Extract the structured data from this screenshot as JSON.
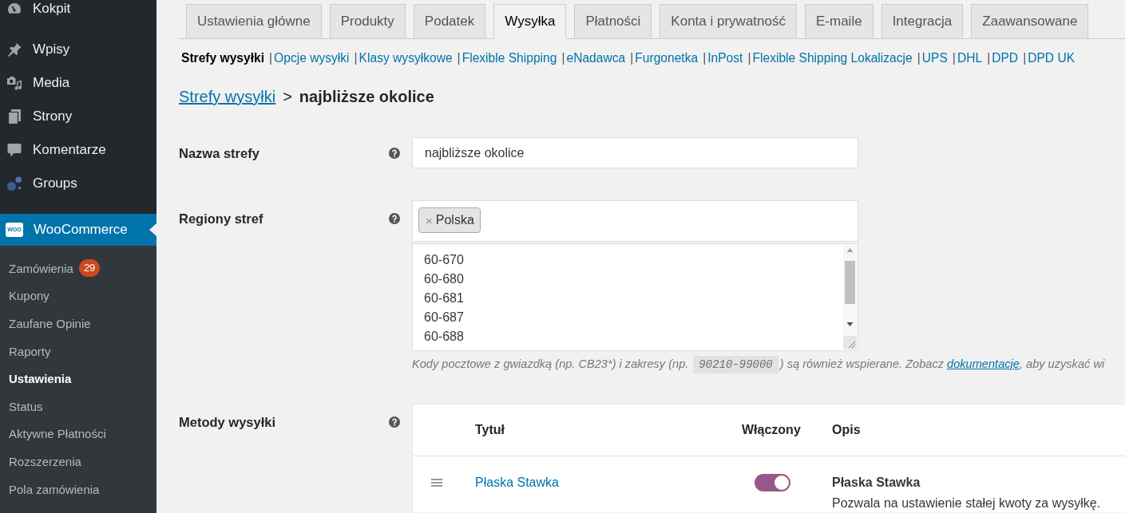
{
  "sidebar": {
    "menu": [
      {
        "label": "Kokpit",
        "selected": false
      },
      {
        "label": "Wpisy",
        "selected": false
      },
      {
        "label": "Media",
        "selected": false
      },
      {
        "label": "Strony",
        "selected": false
      },
      {
        "label": "Komentarze",
        "selected": false
      },
      {
        "label": "Groups",
        "selected": false
      },
      {
        "label": "WooCommerce",
        "selected": true,
        "logo_text": "WOO",
        "submenu": [
          {
            "label": "Zamówienia",
            "badge": "29",
            "selected": false
          },
          {
            "label": "Kupony",
            "selected": false
          },
          {
            "label": "Zaufane Opinie",
            "selected": false
          },
          {
            "label": "Raporty",
            "selected": false
          },
          {
            "label": "Ustawienia",
            "selected": true
          },
          {
            "label": "Status",
            "selected": false
          },
          {
            "label": "Aktywne Płatności",
            "selected": false
          },
          {
            "label": "Rozszerzenia",
            "selected": false
          },
          {
            "label": "Pola zamówienia",
            "selected": false
          }
        ]
      }
    ]
  },
  "tabs": [
    {
      "label": "Ustawienia główne",
      "selected": false
    },
    {
      "label": "Produkty",
      "selected": false
    },
    {
      "label": "Podatek",
      "selected": false
    },
    {
      "label": "Wysyłka",
      "selected": true
    },
    {
      "label": "Płatności",
      "selected": false
    },
    {
      "label": "Konta i prywatność",
      "selected": false
    },
    {
      "label": "E-maile",
      "selected": false
    },
    {
      "label": "Integracja",
      "selected": false
    },
    {
      "label": "Zaawansowane",
      "selected": false
    }
  ],
  "subnav": [
    {
      "label": "Strefy wysyłki",
      "selected": true
    },
    {
      "separator": "|",
      "label": "Opcje wysyłki",
      "selected": false
    },
    {
      "separator": "|",
      "label": "Klasy wysyłkowe",
      "selected": false
    },
    {
      "separator": "|",
      "label": "Flexible Shipping",
      "selected": false
    },
    {
      "separator": "|",
      "label": "eNadawca",
      "selected": false
    },
    {
      "separator": "|",
      "label": "Furgonetka",
      "selected": false
    },
    {
      "separator": "|",
      "label": "InPost",
      "selected": false
    },
    {
      "separator": "|",
      "label": "Flexible Shipping Lokalizacje",
      "selected": false
    },
    {
      "separator": "|",
      "label": "UPS",
      "selected": false
    },
    {
      "separator": "|",
      "label": "DHL",
      "selected": false
    },
    {
      "separator": "|",
      "label": "DPD",
      "selected": false
    },
    {
      "separator": "|",
      "label": "DPD UK",
      "selected": false
    }
  ],
  "breadcrumb": {
    "link": "Strefy wysyłki",
    "separator": ">",
    "current": "najbliższe okolice"
  },
  "zone_name": {
    "label": "Nazwa strefy",
    "value": "najbliższe okolice"
  },
  "zone_regions": {
    "label": "Regiony stref",
    "tags": [
      {
        "remove": "×",
        "label": "Polska"
      }
    ],
    "postcodes": [
      "60-670",
      "60-680",
      "60-681",
      "60-687",
      "60-688"
    ],
    "description": {
      "text_1": "Kody pocztowe z gwiazdką (np. CB23*) i zakresy (np.",
      "code": "90210-99000",
      "text_2": ") są również wspierane. Zobacz",
      "link": "dokumentację",
      "text_3": ", aby uzyskać wi"
    }
  },
  "shipping_methods": {
    "label": "Metody wysyłki",
    "columns": [
      "Tytuł",
      "Włączony",
      "Opis"
    ],
    "rows": [
      {
        "title": "Płaska Stawka",
        "enabled": true,
        "description_title": "Płaska Stawka",
        "description": "Pozwala na ustawienie stałej kwoty za wysyłkę."
      }
    ]
  }
}
